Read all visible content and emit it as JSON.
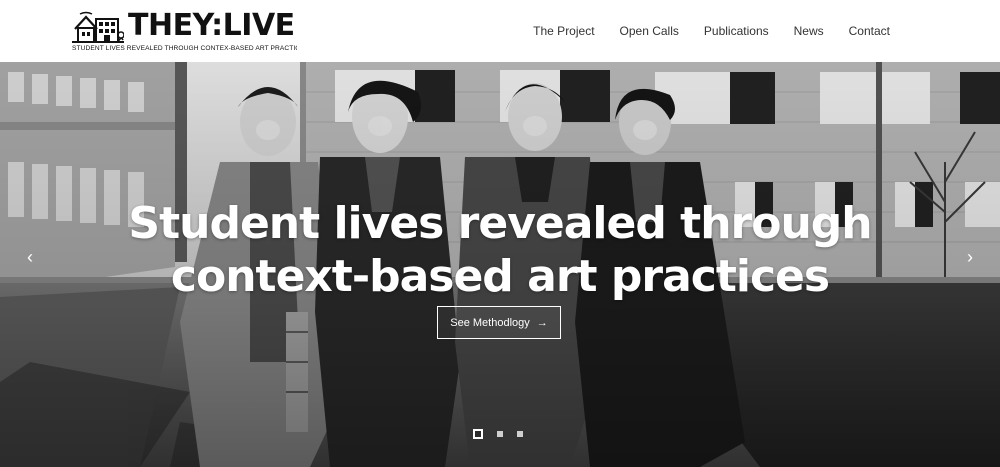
{
  "brand": {
    "title": "THEY:LIVE",
    "tagline": "STUDENT LIVES REVEALED THROUGH CONTEX-BASED ART PRACTICES",
    "icon": "house-logo-icon"
  },
  "nav": {
    "items": [
      {
        "label": "The Project"
      },
      {
        "label": "Open Calls"
      },
      {
        "label": "Publications"
      },
      {
        "label": "News"
      },
      {
        "label": "Contact"
      }
    ]
  },
  "hero": {
    "headline_line1": "Student lives revealed through",
    "headline_line2": "context-based art practices",
    "cta_label": "See Methodlogy",
    "cta_icon": "arrow-right-icon",
    "prev_icon": "chevron-left-icon",
    "next_icon": "chevron-right-icon",
    "slide_count": 3,
    "active_slide": 1,
    "photo_description_icon": "black-and-white-photo"
  },
  "colors": {
    "text_dark": "#111111",
    "nav_text": "#333333",
    "hero_text": "#ffffff",
    "dot_active": "#2b2b2b",
    "dot_inactive": "#cfcfcf"
  }
}
